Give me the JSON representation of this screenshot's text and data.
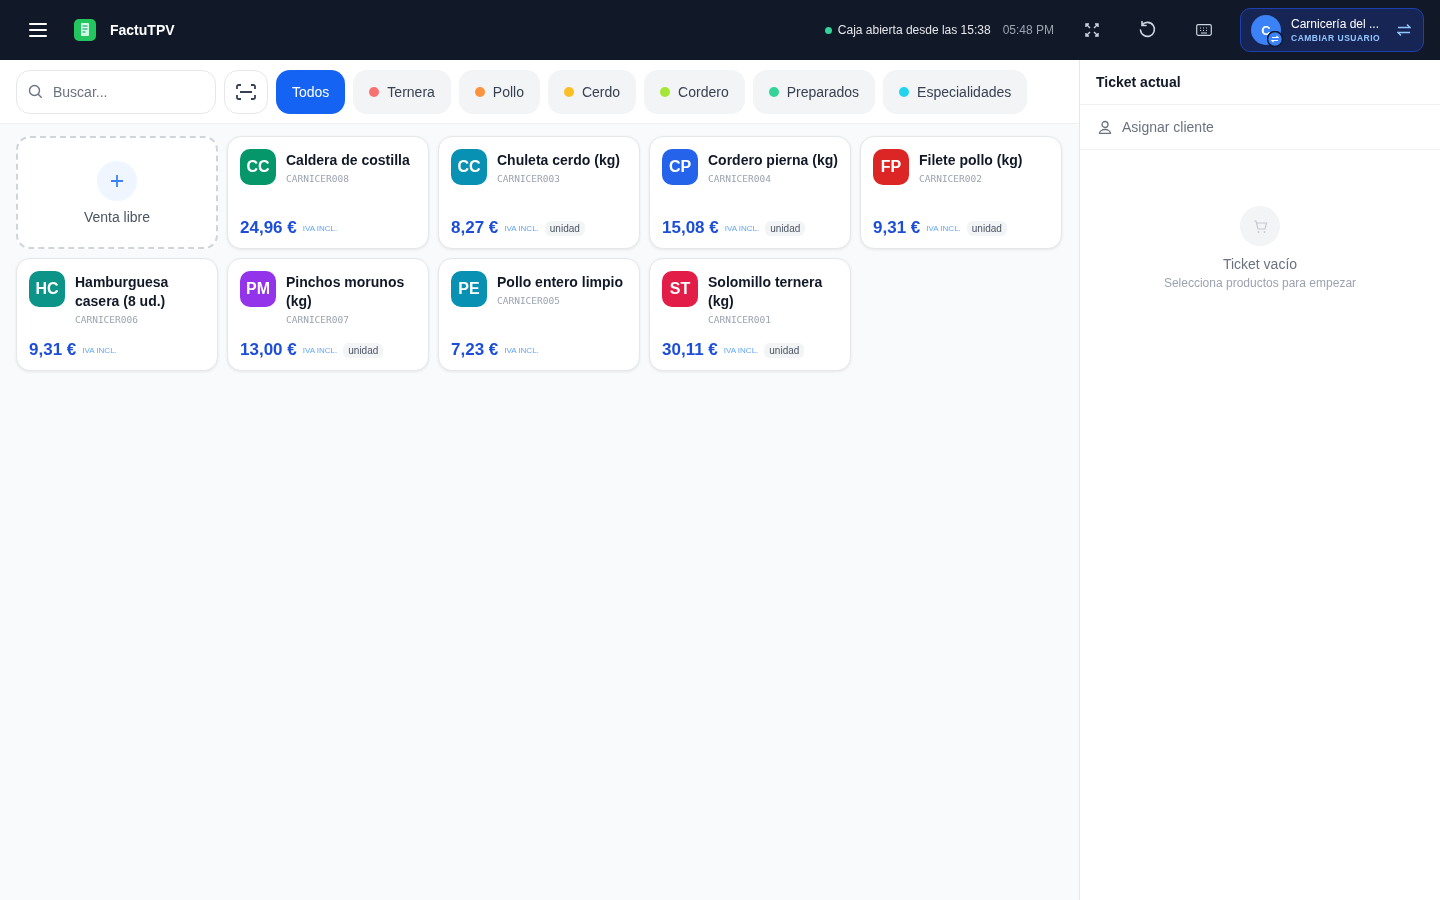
{
  "header": {
    "app_name": "FactuTPV",
    "status": {
      "text": "Caja abierta desde las 15:38",
      "open": true
    },
    "time": "05:48 PM",
    "user": {
      "initial": "C",
      "name": "Carnicería del ...",
      "action": "CAMBIAR USUARIO"
    }
  },
  "search": {
    "placeholder": "Buscar..."
  },
  "categories": [
    {
      "label": "Todos",
      "selected": true
    },
    {
      "label": "Ternera",
      "selected": false,
      "color": "#f87171"
    },
    {
      "label": "Pollo",
      "selected": false,
      "color": "#fb923c"
    },
    {
      "label": "Cerdo",
      "selected": false,
      "color": "#fbbf24"
    },
    {
      "label": "Cordero",
      "selected": false,
      "color": "#a3e635"
    },
    {
      "label": "Preparados",
      "selected": false,
      "color": "#34d399"
    },
    {
      "label": "Especialidades",
      "selected": false,
      "color": "#22d3ee"
    }
  ],
  "free_sale": {
    "label": "Venta libre"
  },
  "products": [
    {
      "initials": "CC",
      "color": "#059669",
      "name": "Caldera de costilla",
      "code": "CARNICER008",
      "price": "24,96 €",
      "tax": "IVA INCL."
    },
    {
      "initials": "CC",
      "color": "#0891b2",
      "name": "Chuleta cerdo (kg)",
      "code": "CARNICER003",
      "price": "8,27 €",
      "tax": "IVA INCL.",
      "unit": "unidad"
    },
    {
      "initials": "CP",
      "color": "#2563eb",
      "name": "Cordero pierna (kg)",
      "code": "CARNICER004",
      "price": "15,08 €",
      "tax": "IVA INCL.",
      "unit": "unidad"
    },
    {
      "initials": "FP",
      "color": "#dc2626",
      "name": "Filete pollo (kg)",
      "code": "CARNICER002",
      "price": "9,31 €",
      "tax": "IVA INCL.",
      "unit": "unidad"
    },
    {
      "initials": "HC",
      "color": "#0d9488",
      "name": "Hamburguesa casera (8 ud.)",
      "code": "CARNICER006",
      "price": "9,31 €",
      "tax": "IVA INCL."
    },
    {
      "initials": "PM",
      "color": "#9333ea",
      "name": "Pinchos morunos (kg)",
      "code": "CARNICER007",
      "price": "13,00 €",
      "tax": "IVA INCL.",
      "unit": "unidad"
    },
    {
      "initials": "PE",
      "color": "#0891b2",
      "name": "Pollo entero limpio",
      "code": "CARNICER005",
      "price": "7,23 €",
      "tax": "IVA INCL."
    },
    {
      "initials": "ST",
      "color": "#e11d48",
      "name": "Solomillo ternera (kg)",
      "code": "CARNICER001",
      "price": "30,11 €",
      "tax": "IVA INCL.",
      "unit": "unidad"
    }
  ],
  "ticket": {
    "title": "Ticket actual",
    "assign_client": "Asignar cliente",
    "empty_title": "Ticket vacío",
    "empty_hint": "Selecciona productos para empezar"
  }
}
